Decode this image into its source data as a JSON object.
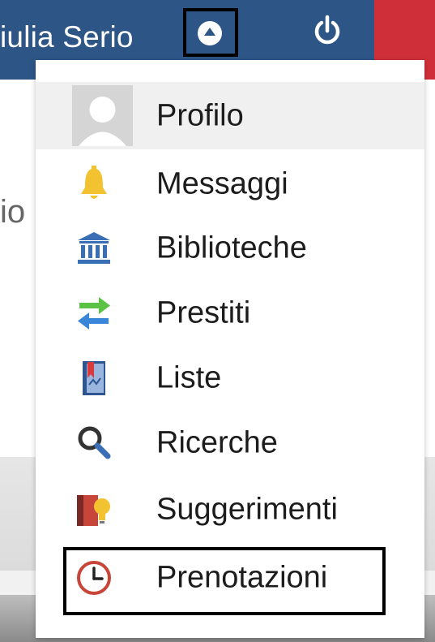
{
  "header": {
    "user_name": "iulia Serio",
    "toggle_icon": "chevron-up-circle-icon",
    "power_icon": "power-icon",
    "colors": {
      "bar": "#2d5687",
      "accent_red": "#cf2f38"
    }
  },
  "background": {
    "partial_text": "io"
  },
  "menu": {
    "items": [
      {
        "label": "Profilo",
        "icon": "avatar-icon",
        "active": true
      },
      {
        "label": "Messaggi",
        "icon": "bell-icon"
      },
      {
        "label": "Biblioteche",
        "icon": "library-icon"
      },
      {
        "label": "Prestiti",
        "icon": "swap-arrows-icon"
      },
      {
        "label": "Liste",
        "icon": "bookmark-book-icon"
      },
      {
        "label": "Ricerche",
        "icon": "search-icon"
      },
      {
        "label": "Suggerimenti",
        "icon": "book-lightbulb-icon"
      },
      {
        "label": "Prenotazioni",
        "icon": "clock-icon",
        "highlighted": true
      }
    ]
  }
}
